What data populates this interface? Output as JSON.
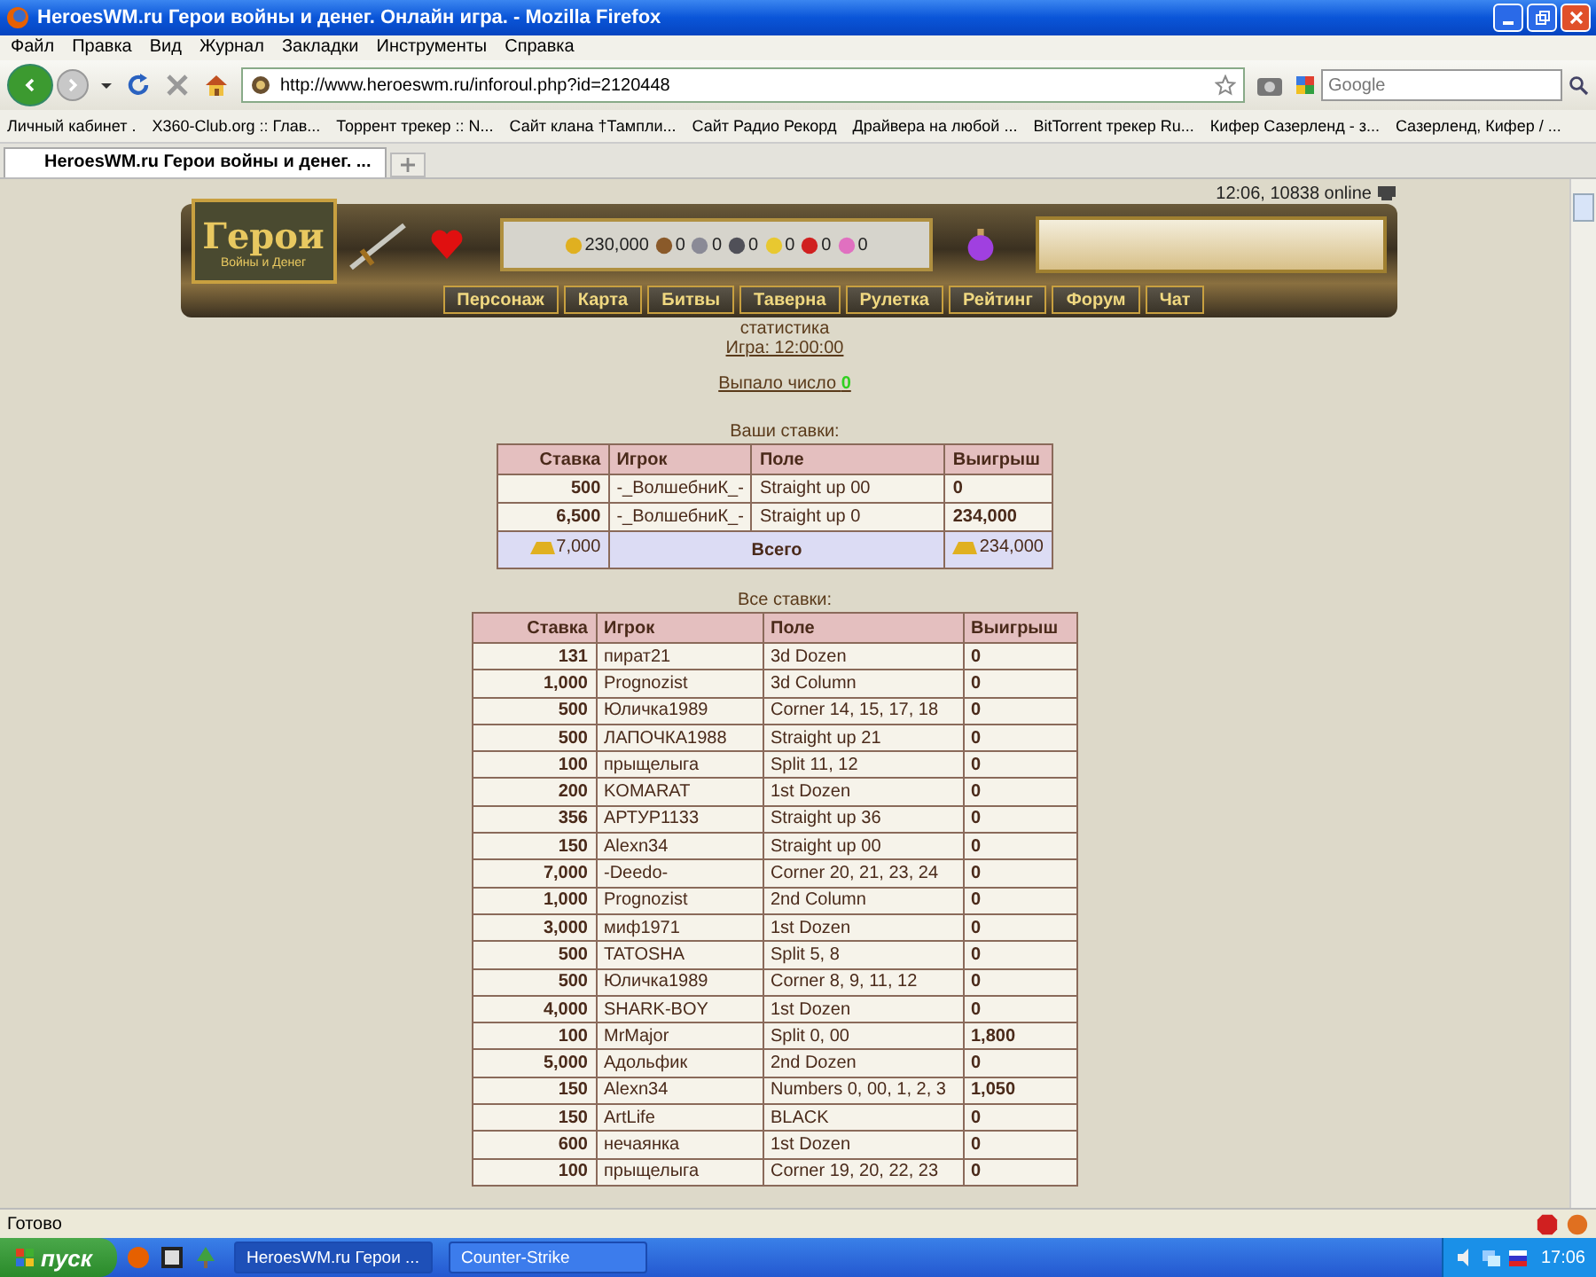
{
  "window": {
    "title": "HeroesWM.ru Герои войны и денег. Онлайн игра. - Mozilla Firefox"
  },
  "menu": [
    "Файл",
    "Правка",
    "Вид",
    "Журнал",
    "Закладки",
    "Инструменты",
    "Справка"
  ],
  "toolbar": {
    "url": "http://www.heroeswm.ru/inforoul.php?id=2120448",
    "search_placeholder": "Google"
  },
  "bookmarks": [
    "Личный кабинет .",
    "X360-Club.org :: Глав...",
    "Торрент трекер :: N...",
    "Сайт клана †Тампли...",
    "Сайт Радио Рекорд",
    "Драйвера на любой ...",
    "BitTorrent трекер Ru...",
    "Кифер Сазерленд - з...",
    "Сазерленд, Кифер / ..."
  ],
  "tabs": [
    {
      "label": "HeroesWM.ru Герои войны и денег. ...",
      "selected": true
    }
  ],
  "game_header": {
    "logo_title": "Герои",
    "logo_subtitle": "Войны и Денег",
    "online": "12:06, 10838 online",
    "resources": [
      {
        "amount": "230,000",
        "color": "#e0b020"
      },
      {
        "amount": "0",
        "color": "#8a5a2a"
      },
      {
        "amount": "0",
        "color": "#8a8a96"
      },
      {
        "amount": "0",
        "color": "#505058"
      },
      {
        "amount": "0",
        "color": "#e8c830"
      },
      {
        "amount": "0",
        "color": "#d02020"
      },
      {
        "amount": "0",
        "color": "#e070c0"
      }
    ],
    "nav": [
      "Персонаж",
      "Карта",
      "Битвы",
      "Таверна",
      "Рулетка",
      "Рейтинг",
      "Форум",
      "Чат"
    ]
  },
  "stats": {
    "heading": "статистика",
    "game_link": "Игра: 12:00:00",
    "result_label": "Выпало число",
    "result_number": "0"
  },
  "your_bets": {
    "caption": "Ваши ставки:",
    "columns": [
      "Ставка",
      "Игрок",
      "Поле",
      "Выигрыш"
    ],
    "rows": [
      [
        "500",
        "-_ВолшебниК_-",
        "Straight up 00",
        "0"
      ],
      [
        "6,500",
        "-_ВолшебниК_-",
        "Straight up 0",
        "234,000"
      ]
    ],
    "total": {
      "stake": "7,000",
      "label": "Всего",
      "win": "234,000"
    }
  },
  "all_bets": {
    "caption": "Все ставки:",
    "columns": [
      "Ставка",
      "Игрок",
      "Поле",
      "Выигрыш"
    ],
    "rows": [
      [
        "131",
        "пират21",
        "3d Dozen",
        "0"
      ],
      [
        "1,000",
        "Prognozist",
        "3d Column",
        "0"
      ],
      [
        "500",
        "Юличка1989",
        "Corner 14, 15, 17, 18",
        "0"
      ],
      [
        "500",
        "ЛАПОЧКА1988",
        "Straight up 21",
        "0"
      ],
      [
        "100",
        "прыщелыга",
        "Split 11, 12",
        "0"
      ],
      [
        "200",
        "KOMARAT",
        "1st Dozen",
        "0"
      ],
      [
        "356",
        "АРТУР1133",
        "Straight up 36",
        "0"
      ],
      [
        "150",
        "Alexn34",
        "Straight up 00",
        "0"
      ],
      [
        "7,000",
        "-Deedo-",
        "Corner 20, 21, 23, 24",
        "0"
      ],
      [
        "1,000",
        "Prognozist",
        "2nd Column",
        "0"
      ],
      [
        "3,000",
        "миф1971",
        "1st Dozen",
        "0"
      ],
      [
        "500",
        "TATOSHA",
        "Split 5, 8",
        "0"
      ],
      [
        "500",
        "Юличка1989",
        "Corner 8, 9, 11, 12",
        "0"
      ],
      [
        "4,000",
        "SHARK-BOY",
        "1st Dozen",
        "0"
      ],
      [
        "100",
        "MrMajor",
        "Split 0, 00",
        "1,800"
      ],
      [
        "5,000",
        "Адольфик",
        "2nd Dozen",
        "0"
      ],
      [
        "150",
        "Alexn34",
        "Numbers 0, 00, 1, 2, 3",
        "1,050"
      ],
      [
        "150",
        "ArtLife",
        "BLACK",
        "0"
      ],
      [
        "600",
        "нечаянка",
        "1st Dozen",
        "0"
      ],
      [
        "100",
        "прыщелыга",
        "Corner 19, 20, 22, 23",
        "0"
      ]
    ]
  },
  "status_bar": {
    "text": "Готово"
  },
  "taskbar": {
    "start": "пуск",
    "tasks": [
      {
        "label": "HeroesWM.ru Герои ...",
        "selected": true
      },
      {
        "label": "Counter-Strike",
        "selected": false
      }
    ],
    "clock": "17:06"
  }
}
